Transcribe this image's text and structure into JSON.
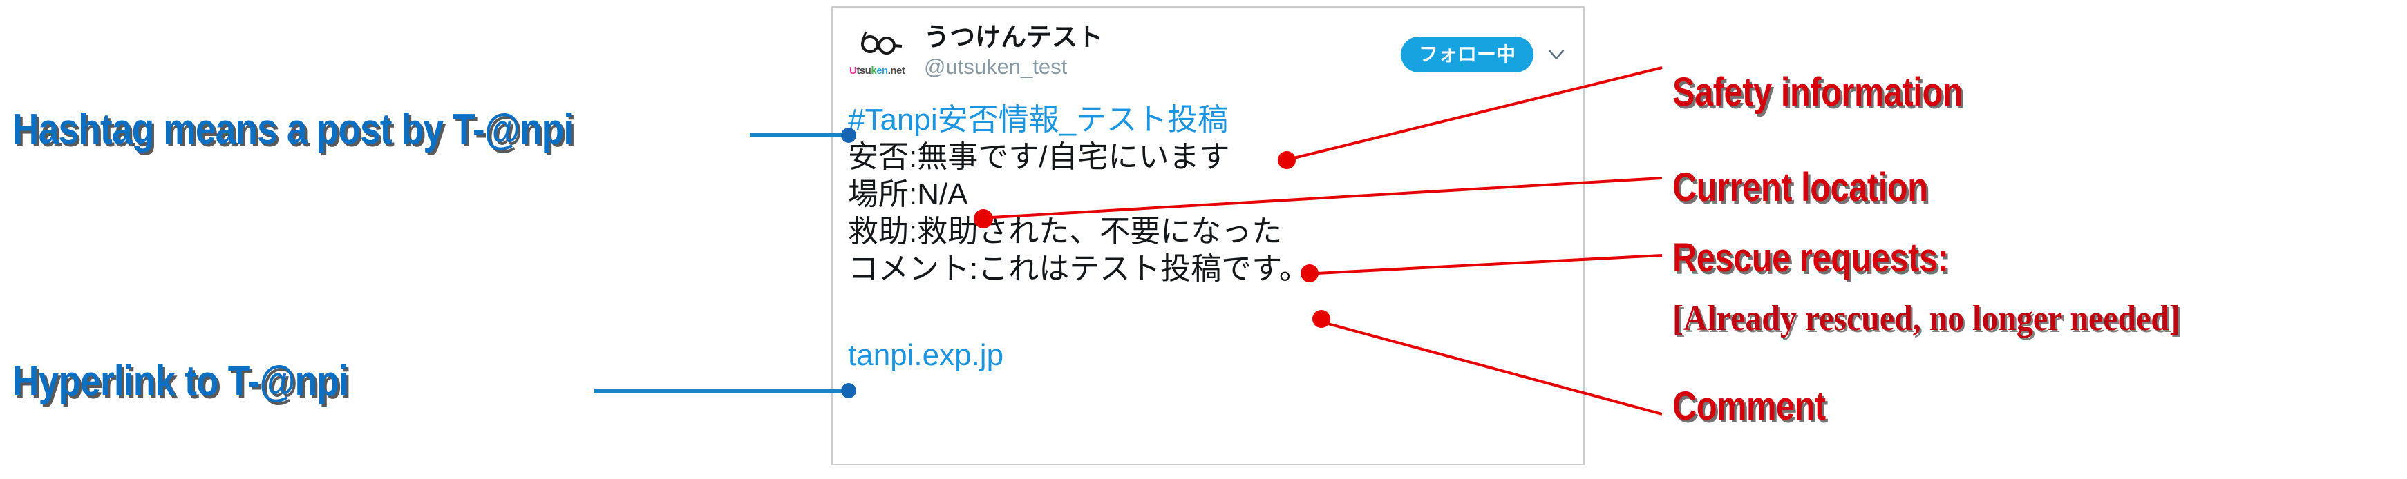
{
  "card": {
    "display_name": "うつけんテスト",
    "handle": "@utsuken_test",
    "avatar_wordmark": {
      "u": "U",
      "tsu": "tsu",
      "k": "k",
      "en": "en",
      "net": ".net"
    },
    "follow_button_label": "フォロー中",
    "chevron_icon": "chevron-down-icon",
    "body_lines": [
      "#Tanpi安否情報_テスト投稿",
      "安否:無事です/自宅にいます",
      "場所:N/A",
      "救助:救助された、不要になった",
      "コメント:これはテスト投稿です。"
    ],
    "link_text": "tanpi.exp.jp"
  },
  "annotations": {
    "blue": [
      {
        "id": "hashtag",
        "text": "Hashtag means a post by T-@npi"
      },
      {
        "id": "hyperlink",
        "text": "Hyperlink to T-@npi"
      }
    ],
    "red": [
      {
        "id": "safety",
        "text": "Safety information"
      },
      {
        "id": "location",
        "text": "Current location"
      },
      {
        "id": "rescue",
        "text": "Rescue requests:"
      },
      {
        "id": "rescue_detail",
        "text": "[Already rescued, no longer needed]"
      },
      {
        "id": "comment",
        "text": "Comment"
      }
    ]
  },
  "colors": {
    "annotation_blue": "#0b6fc4",
    "annotation_red": "#d4000c",
    "link_blue": "#1b95e0",
    "follow_blue": "#17a3e0",
    "handle_gray": "#8899a6",
    "card_border": "#cccccc"
  }
}
